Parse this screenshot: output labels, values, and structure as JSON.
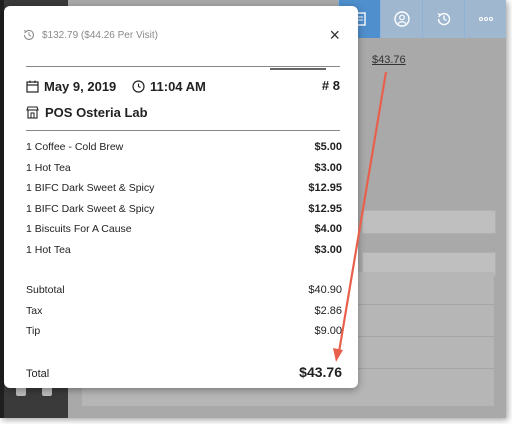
{
  "background": {
    "amount": "$43.76",
    "topbar_icons": [
      "receipt-icon",
      "user-icon",
      "history-icon",
      "more-icon"
    ]
  },
  "receipt": {
    "visit_summary": "$132.79 ($44.26 Per Visit)",
    "date": "May 9, 2019",
    "time": "11:04 AM",
    "order_number": "# 8",
    "store_name": "POS Osteria Lab",
    "items": [
      {
        "label": "1 Coffee - Cold Brew",
        "price": "$5.00"
      },
      {
        "label": "1 Hot Tea",
        "price": "$3.00"
      },
      {
        "label": "1 BIFC Dark Sweet & Spicy",
        "price": "$12.95"
      },
      {
        "label": "1 BIFC Dark Sweet & Spicy",
        "price": "$12.95"
      },
      {
        "label": "1 Biscuits For A Cause",
        "price": "$4.00"
      },
      {
        "label": "1 Hot Tea",
        "price": "$3.00"
      }
    ],
    "subtotal_label": "Subtotal",
    "subtotal": "$40.90",
    "tax_label": "Tax",
    "tax": "$2.86",
    "tip_label": "Tip",
    "tip": "$9.00",
    "total_label": "Total",
    "total": "$43.76"
  },
  "colors": {
    "accent": "#4f8fce",
    "annotation_arrow": "#e8604c"
  }
}
